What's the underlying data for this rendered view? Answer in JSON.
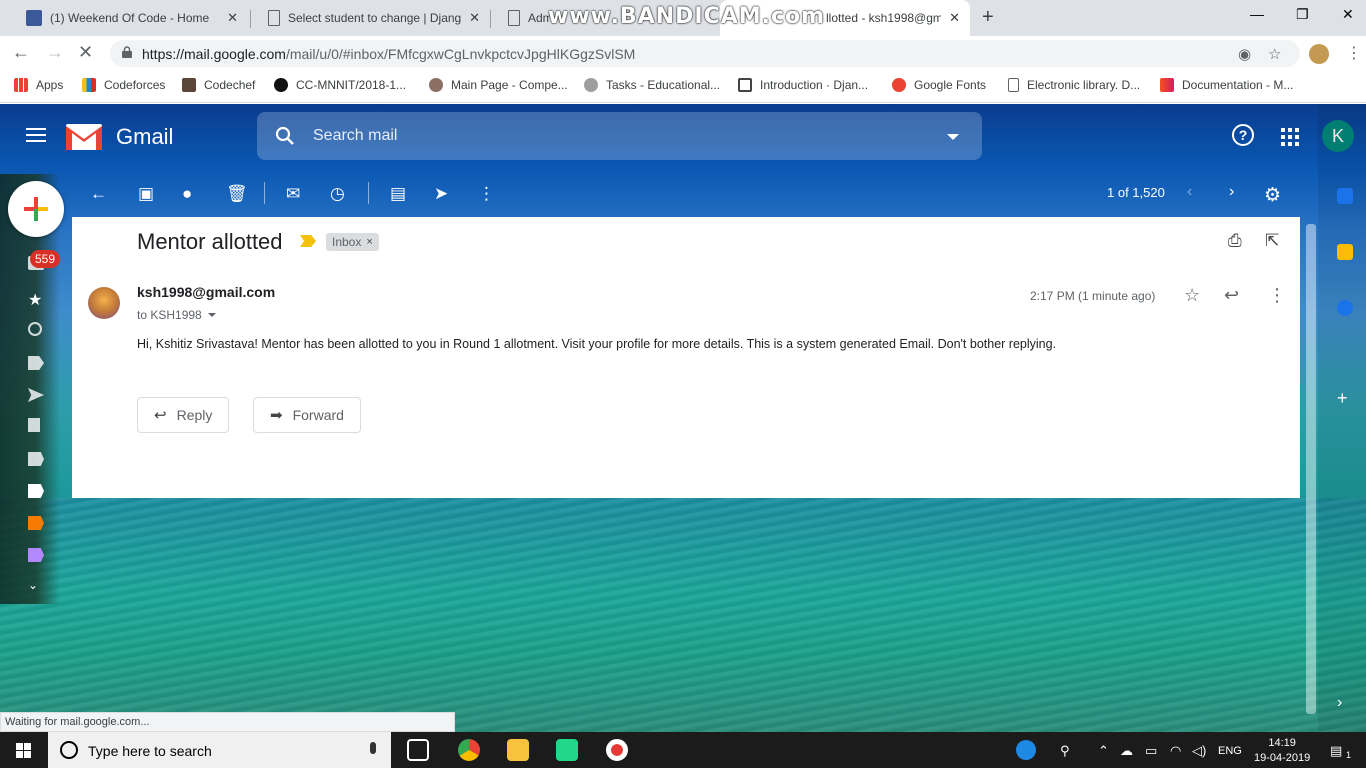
{
  "browser": {
    "tabs": [
      {
        "title": "(1) Weekend Of Code - Home",
        "close": "✕"
      },
      {
        "title": "Select student to change | Djang",
        "close": "✕"
      },
      {
        "title": "Adm",
        "close": ""
      },
      {
        "title": "llotted - ksh1998@gma",
        "close": "✕"
      }
    ],
    "watermark": "www.BANDICAM.com",
    "url_host": "https://mail.google.com",
    "url_path": "/mail/u/0/#inbox/FMfcgxwCgLnvkpctcvJpgHlKGgzSvlSM",
    "bookmarks": [
      {
        "label": "Apps"
      },
      {
        "label": "Codeforces"
      },
      {
        "label": "Codechef"
      },
      {
        "label": "CC-MNNIT/2018-1..."
      },
      {
        "label": "Main Page - Compe..."
      },
      {
        "label": "Tasks - Educational..."
      },
      {
        "label": "Introduction · Djan..."
      },
      {
        "label": "Google Fonts"
      },
      {
        "label": "Electronic library. D..."
      },
      {
        "label": "Documentation - M..."
      }
    ],
    "status_text": "Waiting for mail.google.com..."
  },
  "gmail": {
    "app_name": "Gmail",
    "search_placeholder": "Search mail",
    "account_initial": "K",
    "inbox_count": "559",
    "pager": "1 of 1,520",
    "message": {
      "subject": "Mentor allotted",
      "label": "Inbox",
      "label_remove": "×",
      "sender": "ksh1998@gmail.com",
      "to_line": "to KSH1998",
      "time": "2:17 PM (1 minute ago)",
      "body": "Hi, Kshitiz Srivastava! Mentor has been allotted to you in Round 1 allotment. Visit your profile for more details. This is a system generated Email. Don't bother replying."
    },
    "reply_label": "Reply",
    "forward_label": "Forward"
  },
  "taskbar": {
    "search_placeholder": "Type here to search",
    "language": "ENG",
    "time": "14:19",
    "date": "19-04-2019",
    "notifications": "1"
  },
  "colors": {
    "gmail_red": "#ea4335",
    "badge_red": "#d93025",
    "avatar_teal": "#00897b"
  }
}
